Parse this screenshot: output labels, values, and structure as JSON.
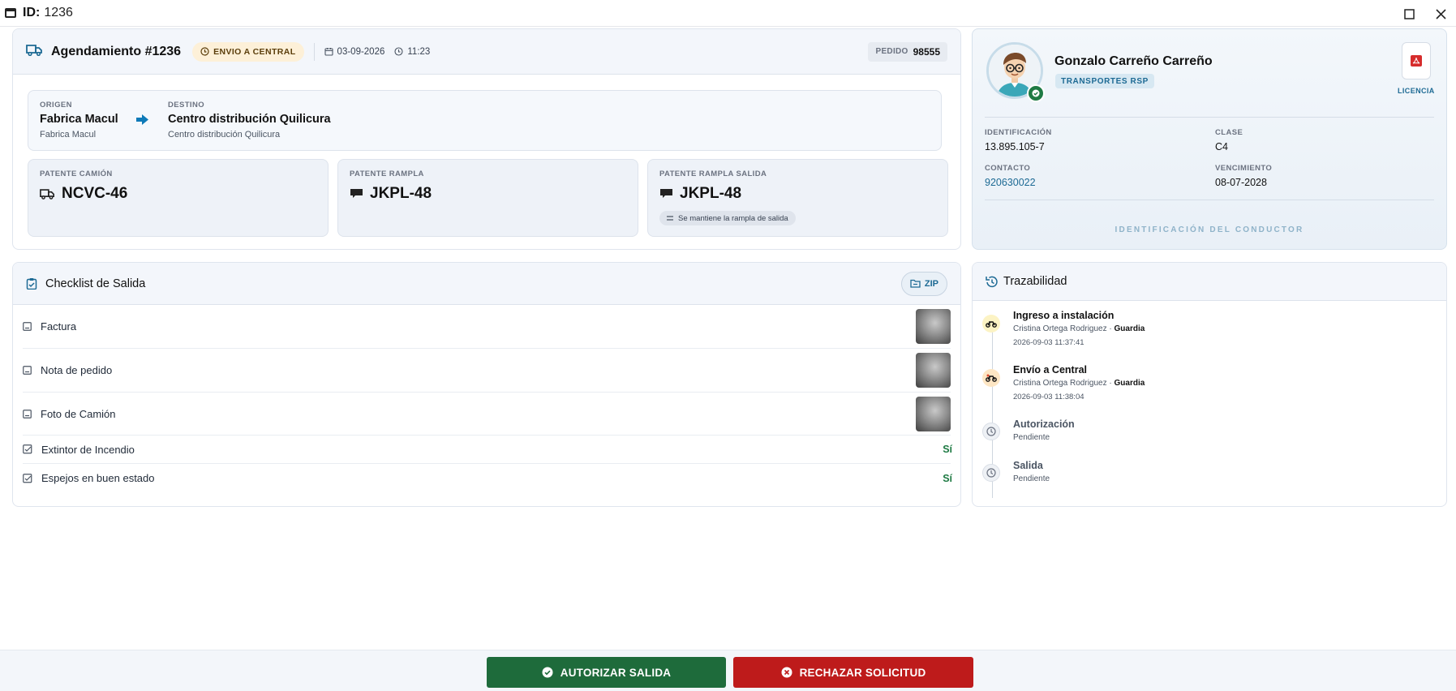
{
  "window": {
    "id_label": "ID:",
    "id_value": "1236"
  },
  "schedule": {
    "title": "Agendamiento #1236",
    "status": "ENVIO A CENTRAL",
    "date": "03-09-2026",
    "time": "11:23",
    "order_label": "PEDIDO",
    "order_value": "98555"
  },
  "route": {
    "origin_label": "ORIGEN",
    "origin_name": "Fabrica Macul",
    "origin_sub": "Fabrica Macul",
    "dest_label": "DESTINO",
    "dest_name": "Centro distribución Quilicura",
    "dest_sub": "Centro distribución Quilicura"
  },
  "plates": {
    "truck_label": "PATENTE CAMIÓN",
    "truck_value": "NCVC-46",
    "trailer_label": "PATENTE RAMPLA",
    "trailer_value": "JKPL-48",
    "trailer_out_label": "PATENTE RAMPLA SALIDA",
    "trailer_out_value": "JKPL-48",
    "trailer_out_note": "Se mantiene la rampla de salida"
  },
  "driver": {
    "name": "Gonzalo Carreño Carreño",
    "company": "TRANSPORTES RSP",
    "license_label": "LICENCIA",
    "id_label": "IDENTIFICACIÓN",
    "id_value": "13.895.105-7",
    "class_label": "CLASE",
    "class_value": "C4",
    "contact_label": "CONTACTO",
    "contact_value": "920630022",
    "expiry_label": "VENCIMIENTO",
    "expiry_value": "08-07-2028",
    "footer": "IDENTIFICACIÓN DEL CONDUCTOR"
  },
  "checklist": {
    "title": "Checklist de Salida",
    "zip_label": "ZIP",
    "photos": [
      "Factura",
      "Nota de pedido",
      "Foto de Camión"
    ],
    "checks": [
      {
        "label": "Extintor de Incendio",
        "value": "Sí"
      },
      {
        "label": "Espejos en buen estado",
        "value": "Sí"
      }
    ]
  },
  "trace": {
    "title": "Trazabilidad",
    "events": [
      {
        "title": "Ingreso a instalación",
        "user": "Cristina Ortega Rodriguez",
        "sep": "·",
        "role": "Guardia",
        "date": "2026-09-03 11:37:41"
      },
      {
        "title": "Envío a Central",
        "user": "Cristina Ortega Rodriguez",
        "sep": "·",
        "role": "Guardia",
        "date": "2026-09-03 11:38:04"
      },
      {
        "title": "Autorización",
        "status": "Pendiente"
      },
      {
        "title": "Salida",
        "status": "Pendiente"
      }
    ]
  },
  "actions": {
    "approve": "AUTORIZAR SALIDA",
    "reject": "RECHAZAR SOLICITUD"
  },
  "colors": {
    "approve": "#1e6b3b",
    "reject": "#be1b1b",
    "accent": "#1d6a94",
    "status_badge": "#fdf0d8",
    "yes": "#1e7a43"
  },
  "icons": [
    "window-icon",
    "maximize-icon",
    "close-icon",
    "truck-icon",
    "clock-icon",
    "calendar-icon",
    "arrow-right-icon",
    "trailer-icon",
    "equal-icon",
    "verified-icon",
    "pdf-icon",
    "clipboard-check-icon",
    "folder-icon",
    "image-icon",
    "checkbox-icon",
    "history-icon",
    "motorcycle-icon",
    "pending-clock-icon",
    "check-circle-icon",
    "x-circle-icon"
  ]
}
